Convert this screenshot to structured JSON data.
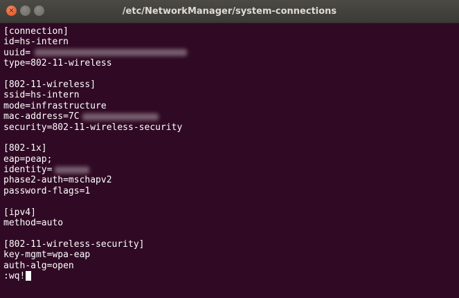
{
  "window": {
    "title": "/etc/NetworkManager/system-connections",
    "close_glyph": "×"
  },
  "terminal": {
    "lines": [
      "[connection]",
      "id=hs-intern",
      "uuid=",
      "type=802-11-wireless",
      "",
      "[802-11-wireless]",
      "ssid=hs-intern",
      "mode=infrastructure",
      "mac-address=7C",
      "security=802-11-wireless-security",
      "",
      "[802-1x]",
      "eap=peap;",
      "identity=",
      "phase2-auth=mschapv2",
      "password-flags=1",
      "",
      "[ipv4]",
      "method=auto",
      "",
      "[802-11-wireless-security]",
      "key-mgmt=wpa-eap",
      "auth-alg=open",
      ":wq!"
    ]
  },
  "colors": {
    "terminal_bg": "#300a24",
    "text": "#ffffff",
    "titlebar": "#3b3a36",
    "close_button": "#df4b16"
  }
}
